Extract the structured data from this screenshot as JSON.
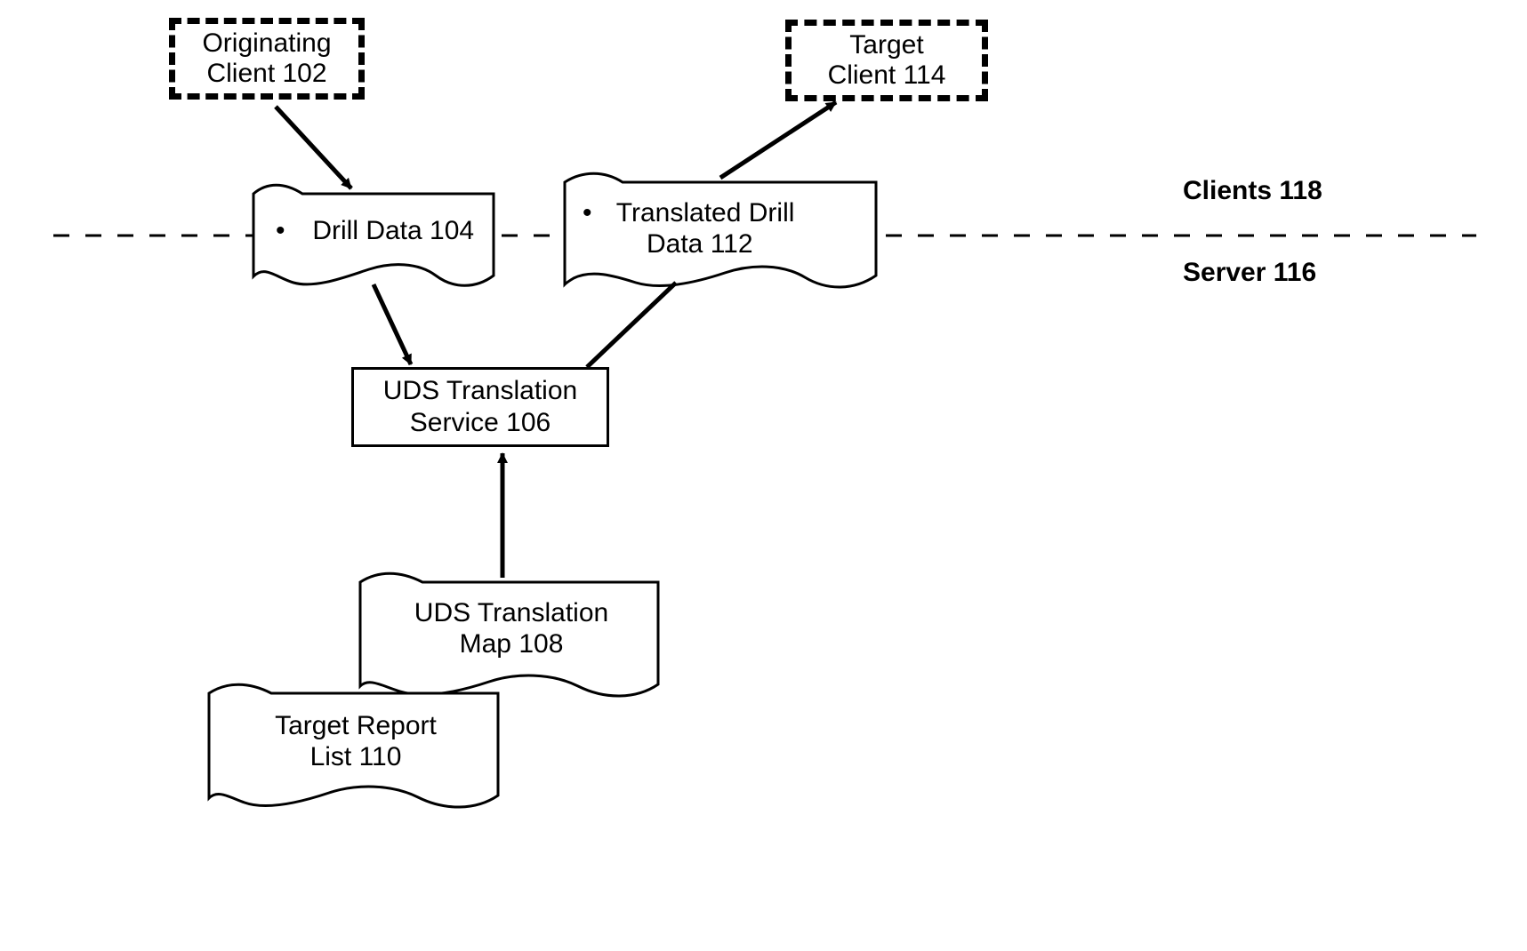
{
  "nodes": {
    "originating_client": {
      "line1": "Originating",
      "line2": "Client 102"
    },
    "target_client": {
      "line1": "Target",
      "line2": "Client 114"
    },
    "drill_data": {
      "bullet": "•",
      "label": "Drill Data 104"
    },
    "translated_drill_data": {
      "bullet": "•",
      "line1": "Translated Drill",
      "line2": "Data 112"
    },
    "uds_service": {
      "line1": "UDS Translation",
      "line2": "Service 106"
    },
    "uds_map": {
      "line1": "UDS Translation",
      "line2": "Map 108"
    },
    "target_report_list": {
      "line1": "Target Report",
      "line2": "List 110"
    }
  },
  "regions": {
    "clients": "Clients 118",
    "server": "Server 116"
  }
}
